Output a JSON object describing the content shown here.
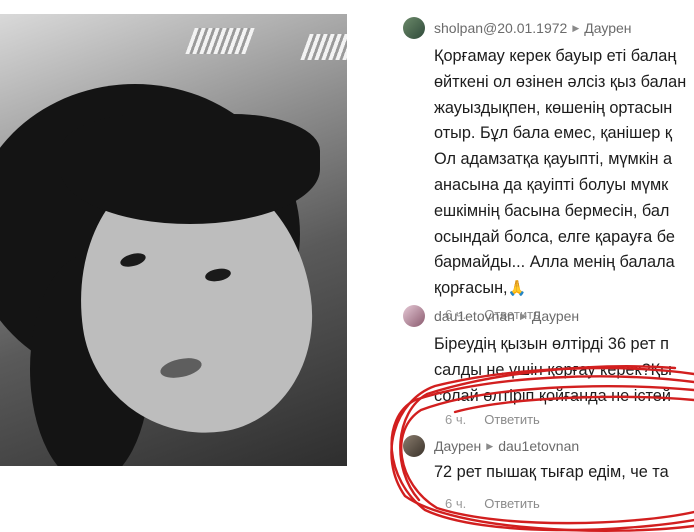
{
  "comments": [
    {
      "user": "sholpan@20.01.1972",
      "reply_to": "Даурен",
      "lines": [
        "Қорғамау керек бауыр еті балаң",
        "өйткені ол өзінен әлсіз қыз балан",
        "жауыздықпен, көшенің ортасын",
        "отыр. Бұл бала емес, қанішер қ",
        "Ол адамзатқа қауыпті, мүмкін а",
        "анасына да қауіпті болуы мүмк",
        "ешкімнің басына бермесін, бал",
        "осындай болса, елге қарауға бе",
        "бармайды... Алла менің балала",
        "қорғасын,"
      ],
      "emoji": "🙏",
      "time": "6 ч.",
      "reply_label": "Ответить"
    },
    {
      "user": "dau1etovnan",
      "reply_to": "Даурен",
      "lines": [
        "Біреудің қызын өлтірді 36 рет п",
        "салды не үшін қорғау керек?Қы",
        "солай өлтіріп қойғанда не істей"
      ],
      "time": "6 ч.",
      "reply_label": "Ответить"
    },
    {
      "user": "Даурен",
      "reply_to": "dau1etovnan",
      "lines": [
        "72 рет пышақ тығар едім, че та"
      ],
      "time": "6 ч.",
      "reply_label": "Ответить"
    }
  ],
  "colors": {
    "username": "#6b6b6b",
    "text": "#1c1c1c",
    "scribble": "#d21f1f"
  }
}
